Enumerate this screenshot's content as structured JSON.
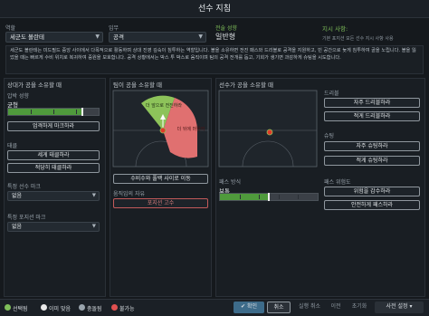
{
  "window": {
    "title": "선수 지침"
  },
  "header": {
    "role_label": "역할",
    "role_value": "세군도 볼란테",
    "duty_label": "임무",
    "duty_value": "공격",
    "tactic_label": "전술 성향",
    "tactic_value": "일반형",
    "instruction_label": "지시 사항:",
    "instruction_value": "기본 포지션 모든 선수 지시 사항 사용"
  },
  "description": "세군도 볼란테는 미드필드 중앙 사이에서 다목적으로 활동하며 상대 진영 깊숙이 침투하는 역할입니다. 볼을 소유하면 전진 패스와 드리블로 공격을 지원하고, 빈 공간으로 늦게 침투하여 골을 노립니다. 볼을 잃었을 때는 빠르게 수비 위치로 복귀하여 중원을 보호합니다. 공격 상황에서는 박스 투 박스로 움직이며 팀의 공격 전개를 돕고, 기회가 생기면 과감하게 슈팅을 시도합니다.",
  "left_panel": {
    "title": "상대가 공을 소유할 때",
    "pressing_label": "압박 성향",
    "pressing_value": "균형",
    "pressing_level": 0.82,
    "mark_tight_btn": "엄격하게 마크하라",
    "tackle_label": "태클",
    "tackle_hard_btn": "세게 태클하라",
    "tackle_soft_btn": "적당히 태클하라",
    "mark_player_label": "특정 선수 마크",
    "mark_player_value": "없음",
    "mark_position_label": "특정 포지션 마크",
    "mark_position_value": "없음"
  },
  "center_panel": {
    "title": "팀이 공을 소유할 때",
    "zone_green_label": "더 앞으로 전진하라",
    "zone_red_label": "더 뒤에 머물러",
    "move_btn": "수비수와 풀백 사이로 이동",
    "freedom_label": "움직임의 자유",
    "hold_position_btn": "포지션 고수"
  },
  "right_panel": {
    "title": "선수가 공을 소유할 때",
    "dribble_label": "드리블",
    "dribble_more_btn": "자주 드리블하라",
    "dribble_less_btn": "적게 드리블하라",
    "shoot_label": "슈팅",
    "shoot_more_btn": "자주 슈팅하라",
    "shoot_less_btn": "적게 슈팅하라",
    "passing_label": "패스 방식",
    "passing_value": "보통",
    "passing_level": 0.5,
    "risk_label": "패스 위험도",
    "risk_less_btn": "위험을 감수하라",
    "risk_safe_btn": "안전하게 패스하라"
  },
  "footer": {
    "legend_selected": "선택됨",
    "legend_already": "이미 맞음",
    "legend_conflict": "충돌됨",
    "legend_unavailable": "불가능",
    "confirm_btn": "확인",
    "cancel_btn": "취소",
    "undo_btn": "실행 취소",
    "prev_btn": "이전",
    "reset_btn": "초기화",
    "preset_btn": "사전 설정"
  },
  "colors": {
    "accent_green": "#7fbf5a",
    "red_zone": "#e07070",
    "bar_fill": "#4f9a3c",
    "confirm": "#3d6b8a"
  }
}
